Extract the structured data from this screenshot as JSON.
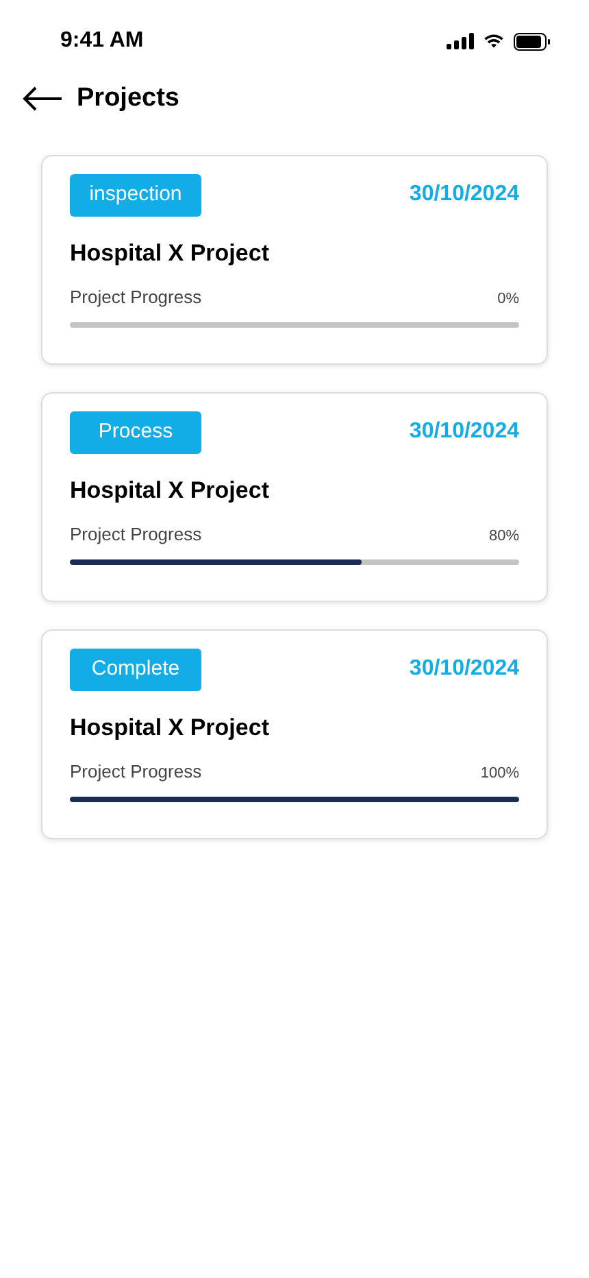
{
  "status_bar": {
    "time": "9:41 AM"
  },
  "header": {
    "title": "Projects"
  },
  "projects": [
    {
      "status": "inspection",
      "date": "30/10/2024",
      "name": "Hospital X Project",
      "progress_label": "Project Progress",
      "percent": "0%",
      "level": 0
    },
    {
      "status": "Process",
      "date": "30/10/2024",
      "name": "Hospital X Project",
      "progress_label": "Project Progress",
      "percent": "80%",
      "level": 0.65
    },
    {
      "status": "Complete",
      "date": "30/10/2024",
      "name": "Hospital X Project",
      "progress_label": "Project Progress",
      "percent": "100%",
      "level": 1
    }
  ]
}
